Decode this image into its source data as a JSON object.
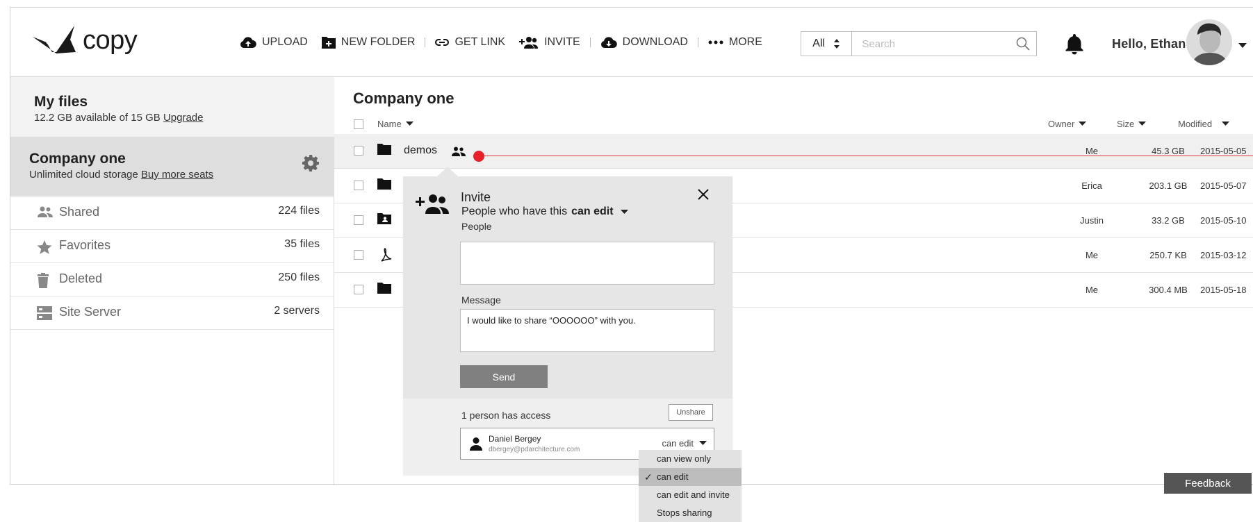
{
  "brand": {
    "name": "copy"
  },
  "toolbar": {
    "upload": "UPLOAD",
    "new_folder": "NEW FOLDER",
    "get_link": "GET LINK",
    "invite": "INVITE",
    "download": "DOWNLOAD",
    "more": "MORE"
  },
  "search": {
    "scope": "All",
    "placeholder": "Search"
  },
  "user": {
    "greeting": "Hello, Ethan"
  },
  "sidebar": {
    "my_files": {
      "title": "My files",
      "storage": "12.2 GB available of 15 GB",
      "upgrade": "Upgrade"
    },
    "company": {
      "title": "Company one",
      "storage": "Unlimited cloud storage",
      "buy": "Buy more seats"
    },
    "items": [
      {
        "label": "Shared",
        "count": "224 files",
        "icon": "people-icon"
      },
      {
        "label": "Favorites",
        "count": "35 files",
        "icon": "star-icon"
      },
      {
        "label": "Deleted",
        "count": "250 files",
        "icon": "trash-icon"
      },
      {
        "label": "Site Server",
        "count": "2 servers",
        "icon": "server-icon"
      }
    ]
  },
  "main": {
    "title": "Company one",
    "columns": {
      "name": "Name",
      "owner": "Owner",
      "size": "Size",
      "modified": "Modified"
    },
    "rows": [
      {
        "name": "demos",
        "owner": "Me",
        "size": "45.3 GB",
        "modified": "2015-05-05",
        "icon": "folder-icon",
        "shared": true
      },
      {
        "name": "",
        "owner": "Erica",
        "size": "203.1 GB",
        "modified": "2015-05-07",
        "icon": "folder-icon"
      },
      {
        "name": "",
        "owner": "Justin",
        "size": "33.2 GB",
        "modified": "2015-05-10",
        "icon": "shared-folder-icon"
      },
      {
        "name": "",
        "owner": "Me",
        "size": "250.7 KB",
        "modified": "2015-03-12",
        "icon": "pdf-icon"
      },
      {
        "name": "",
        "owner": "Me",
        "size": "300.4 MB",
        "modified": "2015-05-18",
        "icon": "folder-icon"
      }
    ]
  },
  "invite": {
    "title": "Invite",
    "subtitle_prefix": "People who have this",
    "subtitle_perm": "can edit",
    "people_label": "People",
    "message_label": "Message",
    "message_value": "I would like to share “OOOOOO” with you.",
    "send": "Send",
    "access_text": "1 person has access",
    "unshare": "Unshare",
    "person": {
      "name": "Daniel Bergey",
      "email": "dbergey@pdarchitecture.com",
      "permission": "can edit"
    }
  },
  "permission_menu": {
    "items": [
      "can view only",
      "can edit",
      "can edit and invite",
      "Stops sharing"
    ],
    "selected": "can edit"
  },
  "feedback": "Feedback",
  "colors": {
    "accent_red": "#e8202a",
    "popover_bg": "#e6e6e6",
    "send_bg": "#808080"
  }
}
